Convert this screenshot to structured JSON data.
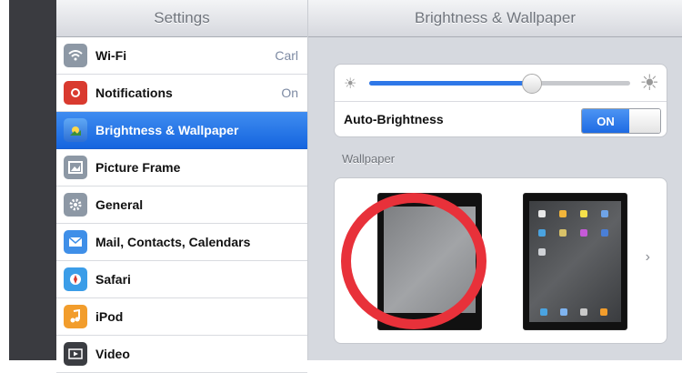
{
  "sidebar": {
    "title": "Settings",
    "items": [
      {
        "label": "Wi-Fi",
        "value": "Carl",
        "icon": "wifi-icon",
        "color": "#8d98a5"
      },
      {
        "label": "Notifications",
        "value": "On",
        "icon": "notifications-icon",
        "color": "#d93a2f"
      },
      {
        "label": "Brightness & Wallpaper",
        "value": "",
        "icon": "brightness-icon",
        "color": "#4b8ef0"
      },
      {
        "label": "Picture Frame",
        "value": "",
        "icon": "picture-frame-icon",
        "color": "#8d98a5"
      },
      {
        "label": "General",
        "value": "",
        "icon": "gear-icon",
        "color": "#8d98a5"
      },
      {
        "label": "Mail, Contacts, Calendars",
        "value": "",
        "icon": "mail-icon",
        "color": "#3f8fe8"
      },
      {
        "label": "Safari",
        "value": "",
        "icon": "safari-icon",
        "color": "#3b9de8"
      },
      {
        "label": "iPod",
        "value": "",
        "icon": "ipod-icon",
        "color": "#f29d2c"
      },
      {
        "label": "Video",
        "value": "",
        "icon": "video-icon",
        "color": "#3b3d42"
      }
    ]
  },
  "main": {
    "title": "Brightness & Wallpaper",
    "brightness_level": 0.62,
    "auto_brightness_label": "Auto-Brightness",
    "switch_label": "ON",
    "wallpaper_section": "Wallpaper",
    "chevron": "›"
  },
  "colors": {
    "accent": "#2f78e8",
    "highlight": "#e8313a"
  }
}
